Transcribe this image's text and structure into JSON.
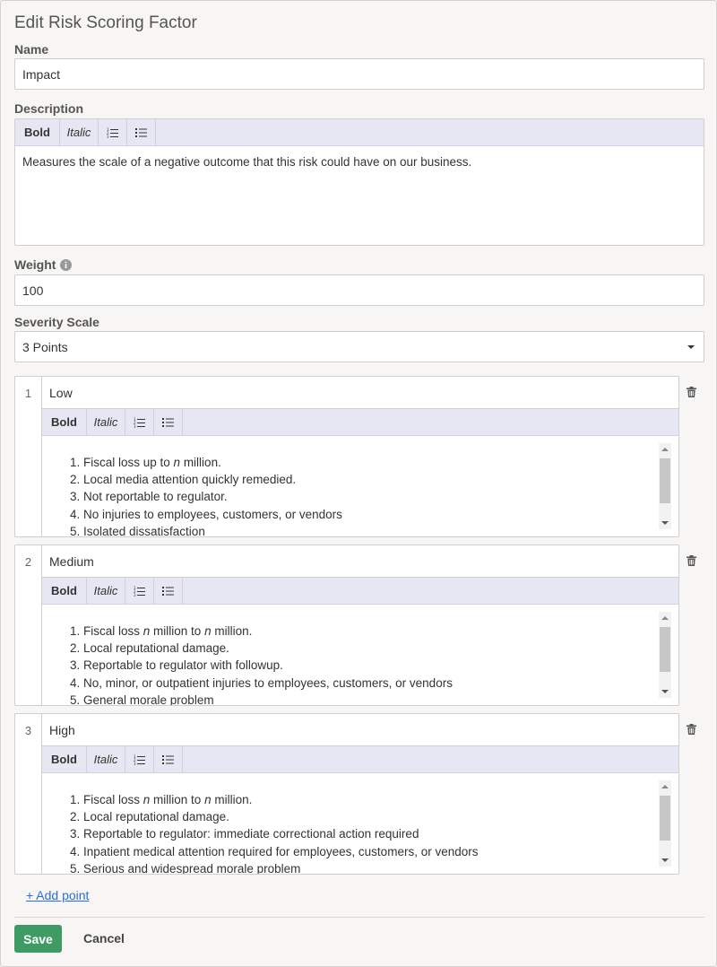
{
  "page": {
    "title": "Edit Risk Scoring Factor"
  },
  "name_field": {
    "label": "Name",
    "value": "Impact"
  },
  "description": {
    "label": "Description",
    "toolbar": {
      "bold": "Bold",
      "italic": "Italic"
    },
    "text": "Measures the scale of a negative outcome that this risk could have on our business."
  },
  "weight": {
    "label": "Weight",
    "value": "100",
    "info_icon": "info-icon"
  },
  "severity_scale": {
    "label": "Severity Scale",
    "selected": "3 Points"
  },
  "points": [
    {
      "number": "1",
      "name": "Low",
      "toolbar": {
        "bold": "Bold",
        "italic": "Italic"
      },
      "items": [
        [
          "Fiscal loss up to ",
          "n",
          " million."
        ],
        [
          "Local media attention quickly remedied."
        ],
        [
          "Not reportable to regulator."
        ],
        [
          "No injuries to employees, customers, or vendors"
        ],
        [
          "Isolated dissatisfaction"
        ]
      ]
    },
    {
      "number": "2",
      "name": "Medium",
      "toolbar": {
        "bold": "Bold",
        "italic": "Italic"
      },
      "items": [
        [
          "Fiscal loss ",
          "n",
          " million to ",
          "n",
          " million."
        ],
        [
          "Local reputational damage."
        ],
        [
          "Reportable to regulator with followup."
        ],
        [
          "No, minor, or outpatient injuries to employees, customers, or vendors"
        ],
        [
          "General morale problem"
        ]
      ]
    },
    {
      "number": "3",
      "name": "High",
      "toolbar": {
        "bold": "Bold",
        "italic": "Italic"
      },
      "items": [
        [
          "Fiscal loss ",
          "n",
          " million to ",
          "n",
          " million."
        ],
        [
          "Local reputational damage."
        ],
        [
          "Reportable to regulator: immediate correctional action required"
        ],
        [
          "Inpatient medical attention required for employees, customers, or vendors"
        ],
        [
          "Serious and widespread morale problem"
        ]
      ]
    }
  ],
  "actions": {
    "add_point": "+ Add point",
    "save": "Save",
    "cancel": "Cancel"
  },
  "colors": {
    "save_button": "#3e9b64",
    "link": "#2a6fd6",
    "toolbar": "#e7e7f3"
  }
}
